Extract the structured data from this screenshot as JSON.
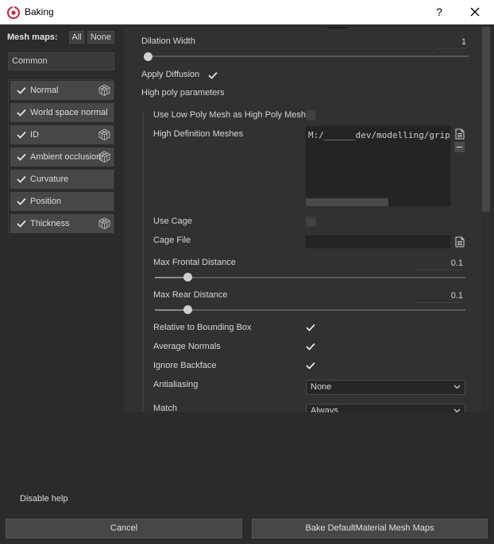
{
  "window": {
    "title": "Baking",
    "help_label": "?",
    "close_icon": "close-icon"
  },
  "left": {
    "header": "Mesh maps:",
    "all_label": "All",
    "none_label": "None",
    "common_label": "Common",
    "items": [
      {
        "label": "Normal",
        "checked": true,
        "has_cube": true
      },
      {
        "label": "World space normal",
        "checked": true,
        "has_cube": false
      },
      {
        "label": "ID",
        "checked": true,
        "has_cube": true
      },
      {
        "label": "Ambient occlusion",
        "checked": true,
        "has_cube": true
      },
      {
        "label": "Curvature",
        "checked": true,
        "has_cube": false
      },
      {
        "label": "Position",
        "checked": true,
        "has_cube": false
      },
      {
        "label": "Thickness",
        "checked": true,
        "has_cube": true
      }
    ]
  },
  "params": {
    "dilation_width_label": "Dilation Width",
    "dilation_width_value": "1",
    "dilation_width_fraction": 0.0,
    "apply_diffusion_label": "Apply Diffusion",
    "apply_diffusion_checked": true,
    "high_poly_header": "High poly parameters",
    "use_low_poly_label": "Use Low Poly Mesh as High Poly Mesh",
    "use_low_poly_checked": false,
    "high_def_meshes_label": "High Definition Meshes",
    "high_def_meshes_path": "M:/______dev/modelling/grip_substance/grip_high.fbx",
    "use_cage_label": "Use Cage",
    "use_cage_checked": false,
    "cage_file_label": "Cage File",
    "max_frontal_label": "Max Frontal Distance",
    "max_frontal_value": "0.1",
    "max_frontal_fraction": 0.1,
    "max_rear_label": "Max Rear Distance",
    "max_rear_value": "0.1",
    "max_rear_fraction": 0.1,
    "relative_bbox_label": "Relative to Bounding Box",
    "relative_bbox_checked": true,
    "average_normals_label": "Average Normals",
    "average_normals_checked": true,
    "ignore_backface_label": "Ignore Backface",
    "ignore_backface_checked": true,
    "antialiasing_label": "Antialiasing",
    "antialiasing_value": "None",
    "match_label": "Match",
    "match_value": "Always"
  },
  "footer": {
    "disable_help_label": "Disable help",
    "cancel_label": "Cancel",
    "bake_label": "Bake DefaultMaterial Mesh Maps"
  },
  "colors": {
    "background": "#2b2b2b",
    "panel": "#313131",
    "accent_logo": "#d21e3a"
  }
}
